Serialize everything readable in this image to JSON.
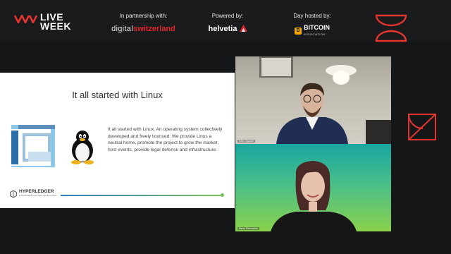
{
  "header": {
    "logo": {
      "line1": "LIVE",
      "line2": "WEEK"
    },
    "sponsors": [
      {
        "caption": "In partnership with:",
        "name_a": "digital",
        "name_b": "switzerland"
      },
      {
        "caption": "Powered by:",
        "name": "helvetia"
      },
      {
        "caption": "Day hosted by:",
        "name": "BITCOIN",
        "sub": "ASSOCIATION",
        "coin": "B"
      }
    ]
  },
  "slide": {
    "title": "It all started with Linux",
    "body": "It all started with Linux. An operating system collectively developed and freely licensed: We provide Linus a neutral home, promote the project to grow the market, host events, provide legal defense and infrastructure.",
    "footer_logo": "HYPERLEDGER",
    "footer_logo_sub": "ENTERPRISE BLOCKCHAIN TECHNOLOGIES"
  },
  "participants": [
    {
      "name": "Marc Gaudart"
    },
    {
      "name": "Maria Pietrowska"
    }
  ],
  "colors": {
    "accent": "#e2232c",
    "brand_red": "#e3342f",
    "background": "#151617"
  },
  "icons": [
    "live-week-logo-icon",
    "helvetia-logo-icon",
    "bitcoin-coin-icon",
    "tux-penguin-icon",
    "hyperledger-icon"
  ]
}
